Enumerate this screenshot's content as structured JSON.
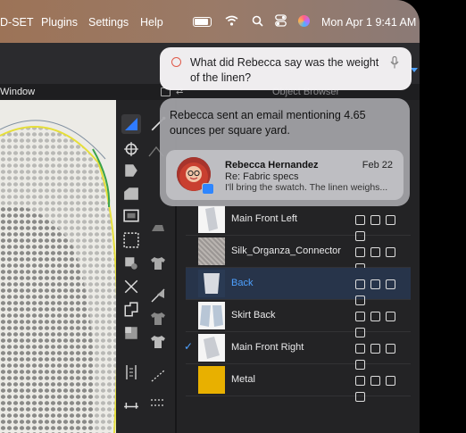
{
  "menubar": {
    "app_menu": "D-SET",
    "items": [
      "Plugins",
      "Settings",
      "Help"
    ],
    "clock": "Mon Apr 1  9:41 AM"
  },
  "sidebar_window_label": "Window",
  "object_browser_label": "Object Browser",
  "siri_query": {
    "text": "What did Rebecca say was the weight of the linen?"
  },
  "siri_answer": {
    "text": "Rebecca sent an email mentioning 4.65 ounces per square yard.",
    "mail": {
      "from": "Rebecca Hernandez",
      "date": "Feb 22",
      "subject": "Re: Fabric specs",
      "preview": "I'll bring the swatch. The linen weighs..."
    }
  },
  "layers": [
    {
      "label": "Main Front Left",
      "selected": false,
      "checked": false
    },
    {
      "label": "Silk_Organza_Connector",
      "selected": false,
      "checked": false
    },
    {
      "label": "Back",
      "selected": true,
      "checked": false
    },
    {
      "label": "Skirt Back",
      "selected": false,
      "checked": false
    },
    {
      "label": "Main Front Right",
      "selected": false,
      "checked": true
    },
    {
      "label": "Metal",
      "selected": false,
      "checked": false
    }
  ],
  "colors": {
    "accent": "#4ea1ff",
    "metal_swatch": "#e8b000",
    "selection": "#27344a"
  }
}
